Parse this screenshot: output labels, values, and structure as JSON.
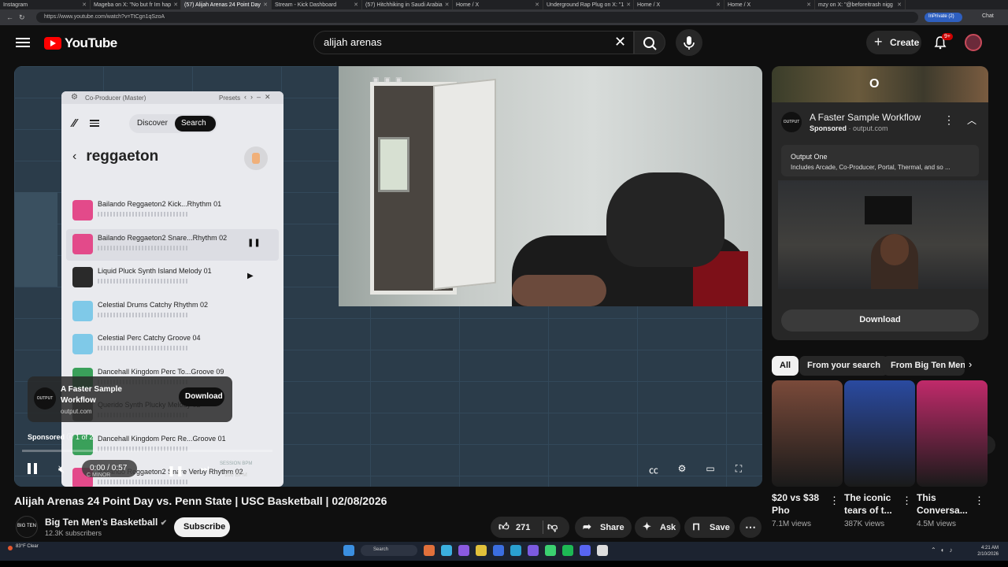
{
  "browser": {
    "tabs": [
      "Instagram",
      "Mageba on X: \"No but fr Im hap",
      "(57) Alijah Arenas 24 Point Day",
      "Stream - Kick Dashboard",
      "(57) Hitchhiking in Saudi Arabia",
      "Home / X",
      "Underground Rap Plug on X: \"1",
      "Home / X",
      "Home / X",
      "mzy on X: \"@beforeitrash nigg"
    ],
    "url": "https://www.youtube.com/watch?v=TtCgn1qSzoA",
    "inprivate": "InPrivate (2)",
    "chat": "Chat"
  },
  "header": {
    "logo": "YouTube",
    "search_query": "alijah arenas",
    "create": "Create",
    "notif_badge": "9+"
  },
  "plugin": {
    "title": "Co-Producer (Master)",
    "presets": "Presets",
    "tab_discover": "Discover",
    "tab_search": "Search",
    "query": "reggaeton",
    "samples": [
      {
        "name": "Bailando Reggaeton2 Kick...Rhythm 01",
        "color": "#e34a8a"
      },
      {
        "name": "Bailando Reggaeton2 Snare...Rhythm 02",
        "color": "#e34a8a"
      },
      {
        "name": "Liquid Pluck Synth Island Melody 01",
        "color": "#2a2a2a"
      },
      {
        "name": "Celestial Drums Catchy Rhythm 02",
        "color": "#7fc9e8"
      },
      {
        "name": "Celestial Perc Catchy Groove 04",
        "color": "#7fc9e8"
      },
      {
        "name": "Dancehall Kingdom Perc To...Groove 09",
        "color": "#3aa05a"
      },
      {
        "name": "Querido Synth Plucky Melody 02",
        "color": "#6a6a6a"
      },
      {
        "name": "Dancehall Kingdom Perc Re...Groove 01",
        "color": "#3aa05a"
      },
      {
        "name": "Bailando Reggaeton2 Snare Verby Rhythm 02",
        "color": "#e34a8a"
      }
    ]
  },
  "player": {
    "ad_title": "A Faster Sample Workflow",
    "ad_domain": "output.com",
    "ad_download": "Download",
    "sponsored": "Sponsored",
    "sponsor_count": "1 of 2",
    "time": "0:00 / 0:57",
    "progress": 0,
    "key": "C MINOR",
    "bpm_label": "SESSION BPM",
    "bpm": "100 BPM"
  },
  "video": {
    "title": "Alijah Arenas 24 Point Day vs. Penn State | USC Basketball | 02/08/2026",
    "channel": "Big Ten Men's Basketball",
    "channel_logo": "BIG TEN",
    "subscribers": "12.3K subscribers",
    "subscribe": "Subscribe",
    "likes": "271",
    "share": "Share",
    "ask": "Ask",
    "save": "Save"
  },
  "sidebar": {
    "ad_logo": "OUTPUT",
    "ad_title": "A Faster Sample Workflow",
    "ad_sponsored": "Sponsored",
    "ad_domain": "output.com",
    "box_title": "Output One",
    "box_desc": "Includes Arcade, Co-Producer, Portal, Thermal, and so ...",
    "download": "Download",
    "chips": [
      "All",
      "From your search",
      "From Big Ten Men"
    ],
    "shorts": [
      {
        "title": "$20 vs $38 Pho",
        "views": "7.1M views",
        "color": "#7a4a3a"
      },
      {
        "title": "The iconic tears of t...",
        "views": "387K views",
        "color": "#2a4aa0"
      },
      {
        "title": "This Conversa...",
        "views": "4.5M views",
        "color": "#c02a6a"
      }
    ]
  },
  "taskbar": {
    "weather": "83°F Clear",
    "search": "Search",
    "time": "4:21 AM",
    "date": "2/10/2026"
  }
}
